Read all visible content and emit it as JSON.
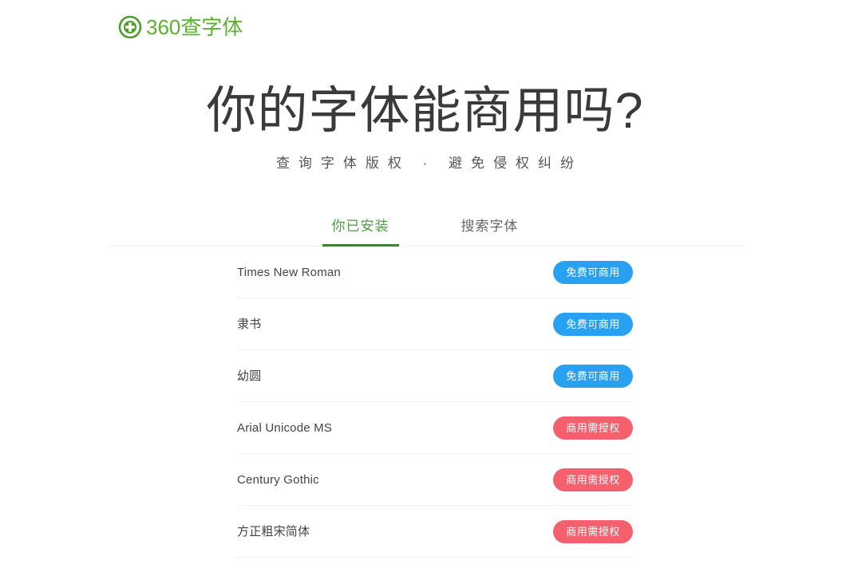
{
  "brand": {
    "logo_icon": "circle-plus-shield-icon",
    "logo_text": "360查字体",
    "logo_color": "#5cb030"
  },
  "hero": {
    "title": "你的字体能商用吗?",
    "subtitle": "查询字体版权 · 避免侵权纠纷"
  },
  "tabs": [
    {
      "label": "你已安装",
      "active": true
    },
    {
      "label": "搜索字体",
      "active": false
    }
  ],
  "badges": {
    "free_label": "免费可商用",
    "licensed_label": "商用需授权",
    "free_color": "#29a1f2",
    "licensed_color": "#f4616d"
  },
  "fonts": [
    {
      "name": "Times New Roman",
      "status": "免费可商用",
      "status_type": "free"
    },
    {
      "name": "隶书",
      "status": "免费可商用",
      "status_type": "free"
    },
    {
      "name": "幼圆",
      "status": "免费可商用",
      "status_type": "free"
    },
    {
      "name": "Arial Unicode MS",
      "status": "商用需授权",
      "status_type": "licensed"
    },
    {
      "name": "Century Gothic",
      "status": "商用需授权",
      "status_type": "licensed"
    },
    {
      "name": "方正粗宋简体",
      "status": "商用需授权",
      "status_type": "licensed"
    }
  ]
}
